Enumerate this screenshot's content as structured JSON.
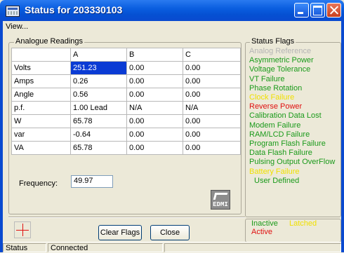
{
  "window": {
    "title": "Status for 203330103"
  },
  "menu": {
    "view": "View..."
  },
  "readings": {
    "group_label": "Analogue Readings",
    "columns": [
      "",
      "A",
      "B",
      "C"
    ],
    "rows": [
      [
        "Volts",
        "251.23",
        "0.00",
        "0.00"
      ],
      [
        "Amps",
        "0.26",
        "0.00",
        "0.00"
      ],
      [
        "Angle",
        "0.56",
        "0.00",
        "0.00"
      ],
      [
        "p.f.",
        "1.00 Lead",
        "N/A",
        "N/A"
      ],
      [
        "W",
        "65.78",
        "0.00",
        "0.00"
      ],
      [
        "var",
        "-0.64",
        "0.00",
        "0.00"
      ],
      [
        "VA",
        "65.78",
        "0.00",
        "0.00"
      ]
    ],
    "frequency_label": "Frequency:",
    "frequency_value": "49.97",
    "logo_text": "EDMI"
  },
  "flags": {
    "group_label": "Status Flags",
    "items": [
      {
        "label": "Analog Reference",
        "color": "#b4b4b4"
      },
      {
        "label": "Asymmetric Power",
        "color": "#1a9a1a"
      },
      {
        "label": "Voltage Tolerance",
        "color": "#1a9a1a"
      },
      {
        "label": "VT Failure",
        "color": "#1a9a1a"
      },
      {
        "label": "Phase Rotation",
        "color": "#1a9a1a"
      },
      {
        "label": "Clock Failure",
        "color": "#f0e000"
      },
      {
        "label": "Reverse Power",
        "color": "#e01010"
      },
      {
        "label": "Calibration Data Lost",
        "color": "#1a9a1a"
      },
      {
        "label": "Modem Failure",
        "color": "#1a9a1a"
      },
      {
        "label": "RAM/LCD Failure",
        "color": "#1a9a1a"
      },
      {
        "label": "Program Flash Failure",
        "color": "#1a9a1a"
      },
      {
        "label": "Data Flash Failure",
        "color": "#1a9a1a"
      },
      {
        "label": "Pulsing Output OverFlow",
        "color": "#1a9a1a"
      },
      {
        "label": "Battery Failure",
        "color": "#f0e000"
      },
      {
        "label": "User Defined",
        "color": "#1a9a1a"
      }
    ],
    "legend": [
      {
        "label": "Inactive",
        "color": "#1a9a1a"
      },
      {
        "label": "Latched",
        "color": "#f0e000"
      },
      {
        "label": "Active",
        "color": "#e01010"
      }
    ]
  },
  "buttons": {
    "clear_flags": "Clear Flags",
    "close": "Close"
  },
  "statusbar": {
    "label": "Status",
    "value": "Connected"
  }
}
